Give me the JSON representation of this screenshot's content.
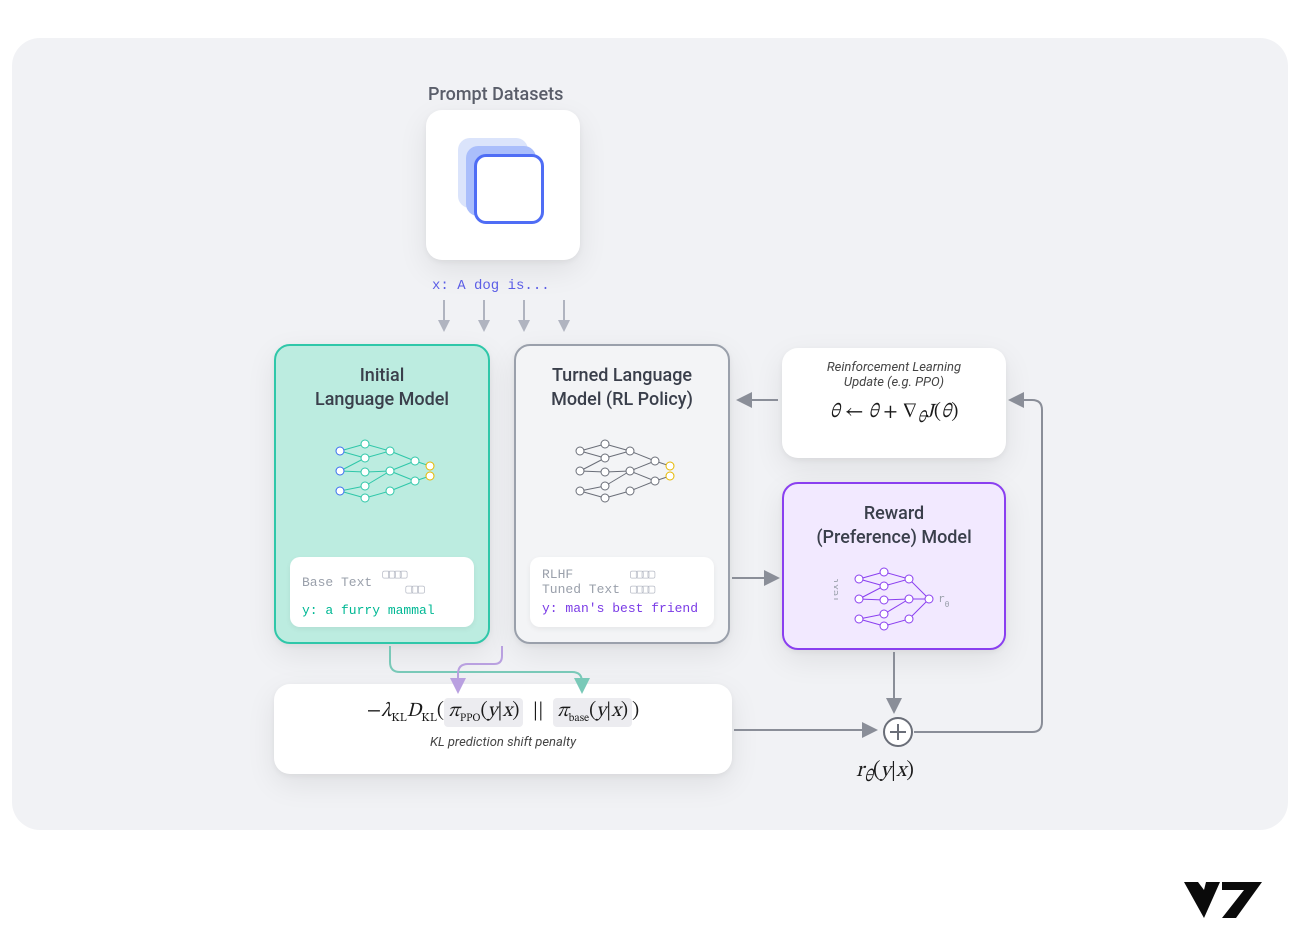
{
  "figure": {
    "prompt_datasets": "Prompt Datasets",
    "prompt_example": "x: A dog is...",
    "initial_model": {
      "title_line1": "Initial",
      "title_line2": "Language Model",
      "output_label": "Base Text",
      "output_y": "y: a furry mammal"
    },
    "tuned_model": {
      "title_line1": "Turned Language",
      "title_line2": "Model (RL Policy)",
      "output_label_line1": "RLHF",
      "output_label_line2": "Tuned Text",
      "output_y": "y: man's best friend"
    },
    "rl_update": {
      "note_line1": "Reinforcement Learning",
      "note_line2": "Update (e.g. PPO)",
      "formula": "θ ← θ + ∇θ J(θ)"
    },
    "reward_model": {
      "title_line1": "Reward",
      "title_line2": "(Preference) Model",
      "input_label": "Text",
      "output_label": "rθ"
    },
    "kl_block": {
      "formula_prefix": "−λ",
      "formula_kl": "KL",
      "formula_D": "D",
      "pi_ppo": "πPPO(y|x)",
      "pi_base": "πbase(y|x)",
      "separator": "||",
      "caption": "KL prediction shift penalty"
    },
    "reward_formula": "rθ(y|x)",
    "logo": "V7"
  }
}
